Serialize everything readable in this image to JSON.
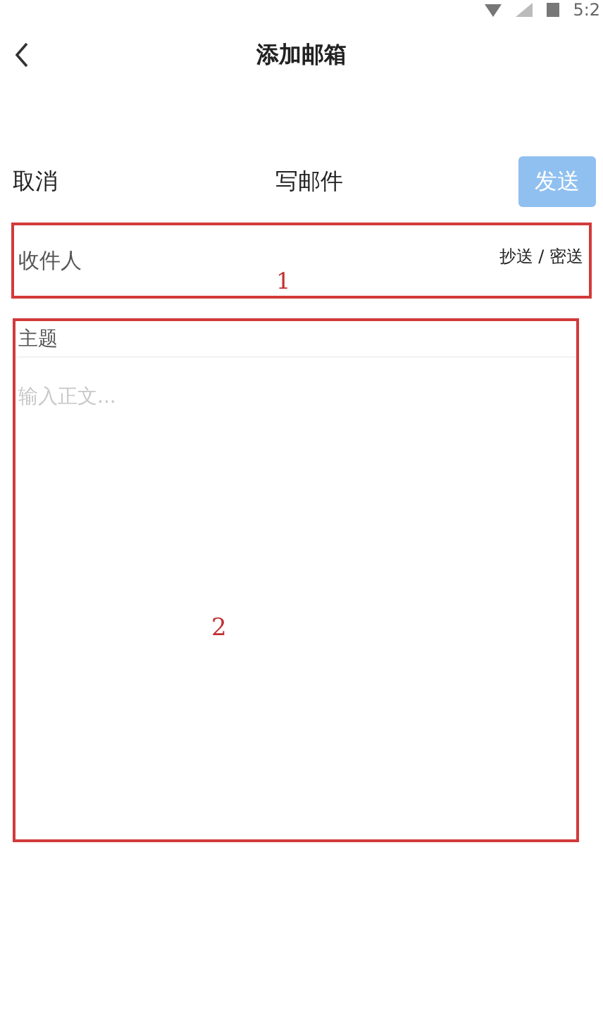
{
  "status_bar": {
    "time": "5:2"
  },
  "header": {
    "title": "添加邮箱"
  },
  "compose_bar": {
    "cancel": "取消",
    "title": "写邮件",
    "send": {
      "label": "发送",
      "disabled": true
    }
  },
  "recipient": {
    "placeholder": "收件人",
    "cc_bcc": "抄送 / 密送"
  },
  "subject": {
    "placeholder": "主题"
  },
  "body": {
    "placeholder": "输入正文..."
  },
  "annotations": [
    {
      "label": "1"
    },
    {
      "label": "2"
    }
  ]
}
